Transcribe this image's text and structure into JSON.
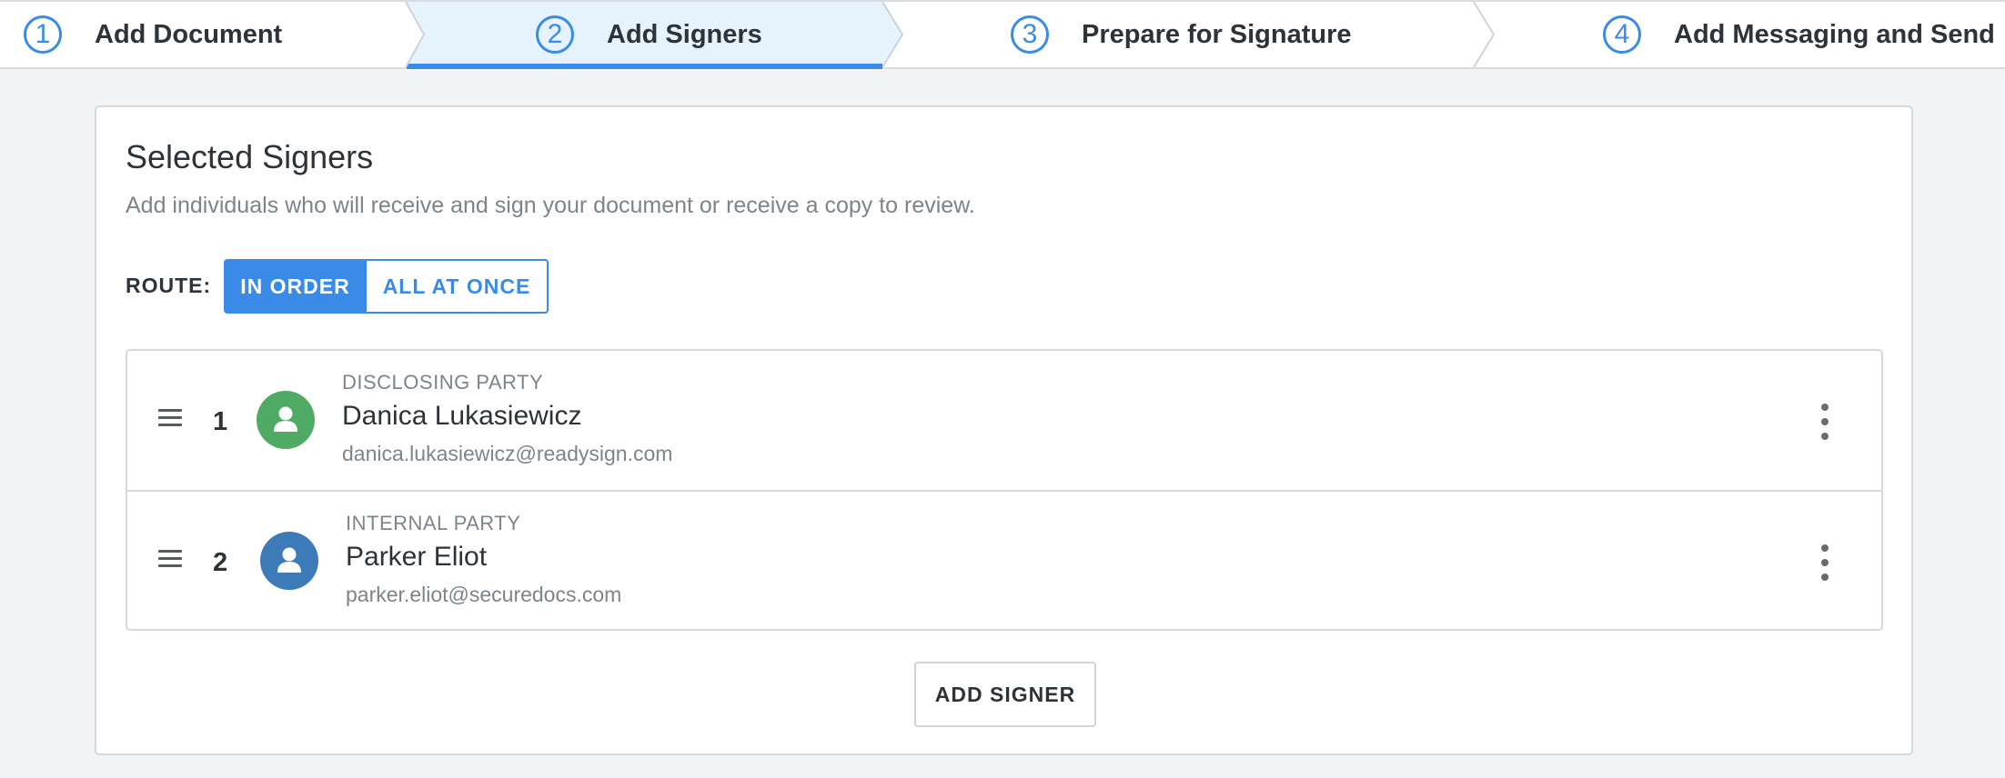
{
  "stepper": {
    "steps": [
      {
        "number": "1",
        "label": "Add Document",
        "active": false
      },
      {
        "number": "2",
        "label": "Add Signers",
        "active": true
      },
      {
        "number": "3",
        "label": "Prepare for Signature",
        "active": false
      },
      {
        "number": "4",
        "label": "Add Messaging and Send",
        "active": false
      }
    ]
  },
  "card": {
    "title": "Selected Signers",
    "subtitle": "Add individuals who will receive and sign your document or receive a copy to review."
  },
  "route": {
    "label": "ROUTE:",
    "options": [
      "IN ORDER",
      "ALL AT ONCE"
    ],
    "selected": "IN ORDER"
  },
  "signers": [
    {
      "order": "1",
      "role": "DISCLOSING PARTY",
      "name": "Danica Lukasiewicz",
      "email": "danica.lukasiewicz@readysign.com",
      "avatar_color": "#4faa63",
      "avatar_icon": "user-icon"
    },
    {
      "order": "2",
      "role": "INTERNAL PARTY",
      "name": "Parker Eliot",
      "email": "parker.eliot@securedocs.com",
      "avatar_color": "#3d7ab8",
      "avatar_icon": "user-icon"
    }
  ],
  "actions": {
    "add_signer_label": "ADD SIGNER"
  },
  "colors": {
    "accent": "#3a8be8",
    "active_step_bg": "#e6f2fc"
  }
}
